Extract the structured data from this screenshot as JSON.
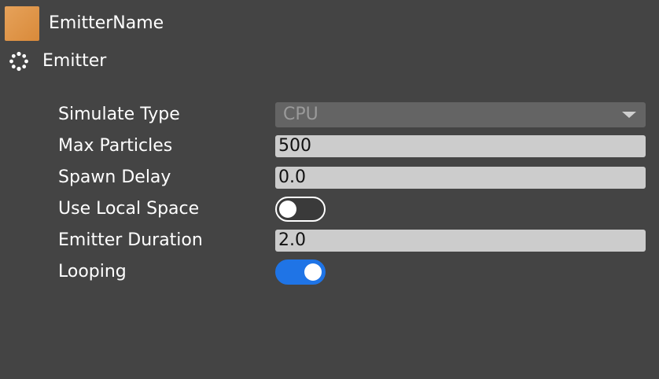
{
  "header": {
    "title": "EmitterName",
    "swatch_color": "#E09A4E"
  },
  "section": {
    "title": "Emitter",
    "icon": "spinner-icon"
  },
  "properties": {
    "simulate_type": {
      "label": "Simulate Type",
      "value": "CPU"
    },
    "max_particles": {
      "label": "Max Particles",
      "value": "500"
    },
    "spawn_delay": {
      "label": "Spawn Delay",
      "value": "0.0"
    },
    "use_local_space": {
      "label": "Use Local Space",
      "checked": false
    },
    "emitter_duration": {
      "label": "Emitter Duration",
      "value": "2.0"
    },
    "looping": {
      "label": "Looping",
      "checked": true
    }
  },
  "colors": {
    "background": "#444444",
    "toggle_on": "#1F74E6",
    "field_bg": "#CCCCCC",
    "select_bg": "#646464"
  }
}
